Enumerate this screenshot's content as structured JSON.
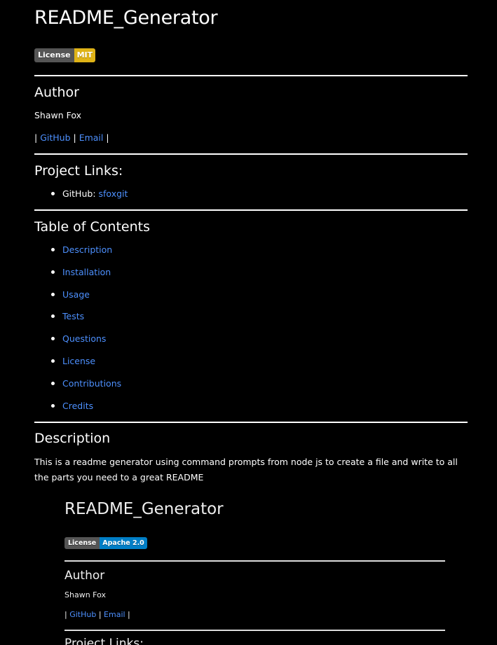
{
  "title": "README_Generator",
  "badge": {
    "label": "License",
    "value": "MIT",
    "color": "#dfb317"
  },
  "author": {
    "heading": "Author",
    "name": "Shawn Fox",
    "sep1": "| ",
    "github_link": "GitHub",
    "sep2": " | ",
    "email_link": "Email",
    "sep3": " |"
  },
  "project_links": {
    "heading": "Project Links:",
    "items": [
      {
        "label": "GitHub: ",
        "link": "sfoxgit"
      }
    ]
  },
  "toc": {
    "heading": "Table of Contents",
    "items": [
      "Description",
      "Installation",
      "Usage",
      "Tests",
      "Questions",
      "License",
      "Contributions",
      "Credits"
    ]
  },
  "description": {
    "heading": "Description",
    "text": "This is a readme generator using command prompts from node js to create a file and write to all the parts you need to a great README"
  },
  "screenshot": {
    "title": "README_Generator",
    "badge": {
      "label": "License",
      "value": "Apache 2.0",
      "color": "#007ec6"
    },
    "author_heading": "Author",
    "author_name": "Shawn Fox",
    "sep1": "| ",
    "github_link": "GitHub",
    "sep2": " | ",
    "email_link": "Email",
    "sep3": " |",
    "project_links_heading": "Project Links:"
  },
  "colors": {
    "background": "#000000",
    "text": "#ffffff",
    "link": "#4d90fe"
  }
}
